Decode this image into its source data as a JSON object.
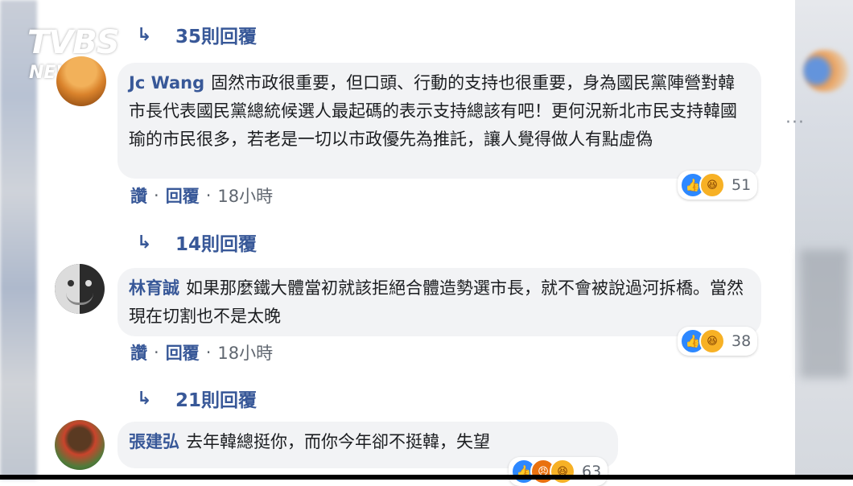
{
  "logo": {
    "brand": "TVBS",
    "sub": "NEWS"
  },
  "icons": {
    "reply_arrow": "↳",
    "like": "👍",
    "haha": "😆",
    "angry": "😠",
    "more": "···"
  },
  "thread": [
    {
      "reply_link": "35則回覆"
    },
    {
      "author": "Jc Wang",
      "text": "固然市政很重要，但口頭、行動的支持也很重要，身為國民黨陣營對韓市長代表國民黨總統候選人最起碼的表示支持總該有吧！更何況新北市民支持韓國瑜的市民很多，若老是一切以市政優先為推託，讓人覺得做人有點虛偽",
      "reactions": "51",
      "actions": {
        "like": "讚",
        "sep": "·",
        "reply": "回覆",
        "time": "18小時"
      },
      "replies": "14則回覆"
    },
    {
      "author": "林育誠",
      "text": "如果那麼鐵大體當初就該拒絕合體造勢選市長，就不會被說過河拆橋。當然現在切割也不是太晚",
      "reactions": "38",
      "actions": {
        "like": "讚",
        "sep": "·",
        "reply": "回覆",
        "time": "18小時"
      },
      "replies": "21則回覆"
    },
    {
      "author": "張建弘",
      "text": "去年韓總挺你，而你今年卻不挺韓，失望",
      "reactions": "63"
    }
  ]
}
